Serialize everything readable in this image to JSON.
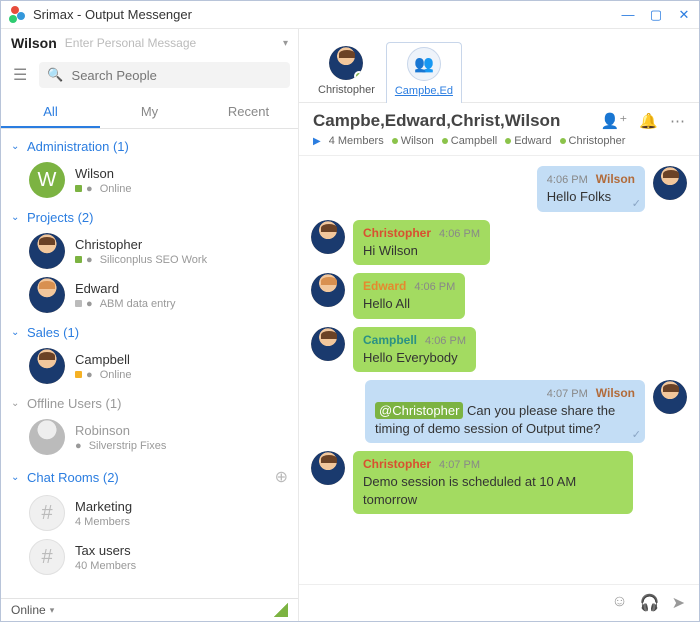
{
  "app": {
    "title": "Srimax - Output Messenger"
  },
  "user": {
    "name": "Wilson",
    "personal_msg_placeholder": "Enter Personal Message"
  },
  "search": {
    "placeholder": "Search People"
  },
  "tabs": {
    "all": "All",
    "my": "My",
    "recent": "Recent"
  },
  "groups": {
    "admin": {
      "label": "Administration  (1)"
    },
    "projects": {
      "label": "Projects  (2)"
    },
    "sales": {
      "label": "Sales  (1)"
    },
    "offline": {
      "label": "Offline Users  (1)"
    },
    "chatrooms": {
      "label": "Chat Rooms  (2)"
    }
  },
  "contacts": {
    "wilson": {
      "name": "Wilson",
      "initial": "W",
      "status": "Online"
    },
    "christopher": {
      "name": "Christopher",
      "status": "Siliconplus SEO Work"
    },
    "edward": {
      "name": "Edward",
      "status": "ABM data entry"
    },
    "campbell": {
      "name": "Campbell",
      "status": "Online"
    },
    "robinson": {
      "name": "Robinson",
      "status": "Silverstrip Fixes"
    }
  },
  "rooms": {
    "marketing": {
      "name": "Marketing",
      "sub": "4 Members"
    },
    "tax": {
      "name": "Tax users",
      "sub": "40 Members"
    }
  },
  "statusbar": {
    "label": "Online"
  },
  "chat": {
    "tabs": {
      "christopher": "Christopher",
      "group": "Campbe,Ed"
    },
    "title": "Campbe,Edward,Christ,Wilson",
    "members_count": "4 Members",
    "members": [
      "Wilson",
      "Campbell",
      "Edward",
      "Christopher"
    ],
    "messages": [
      {
        "side": "right",
        "name": "Wilson",
        "name_color": "name-brown",
        "time": "4:06 PM",
        "body": "Hello Folks",
        "bubble": "blue",
        "tick": true
      },
      {
        "side": "left",
        "name": "Christopher",
        "name_color": "name-red",
        "avatar": "photo",
        "time": "4:06 PM",
        "body": "Hi Wilson",
        "bubble": "green"
      },
      {
        "side": "left",
        "name": "Edward",
        "name_color": "name-orange",
        "avatar": "photo alt",
        "time": "4:06 PM",
        "body": "Hello All",
        "bubble": "green"
      },
      {
        "side": "left",
        "name": "Campbell",
        "name_color": "name-teal",
        "avatar": "photo",
        "time": "4:06 PM",
        "body": "Hello Everybody",
        "bubble": "green"
      },
      {
        "side": "right",
        "name": "Wilson",
        "name_color": "name-brown",
        "time": "4:07 PM",
        "mention": "@Christopher",
        "body": "Can you please share the timing of demo session of Output time?",
        "bubble": "blue",
        "tick": true
      },
      {
        "side": "left",
        "name": "Christopher",
        "name_color": "name-red",
        "avatar": "photo",
        "time": "4:07 PM",
        "body": "Demo session is scheduled at 10 AM tomorrow",
        "bubble": "green"
      }
    ]
  }
}
